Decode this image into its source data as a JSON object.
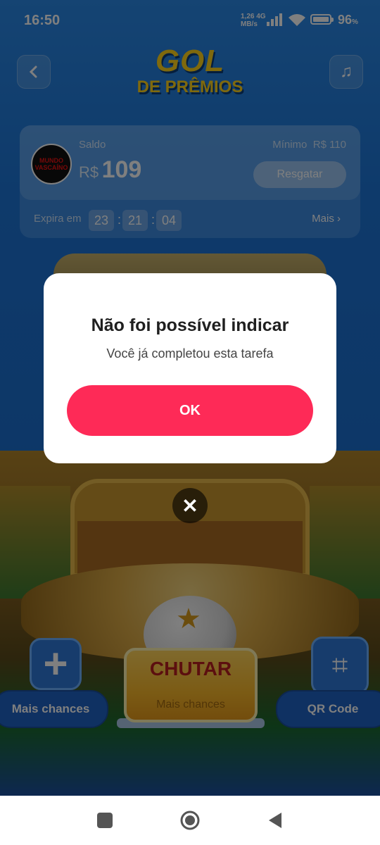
{
  "status_bar": {
    "time": "16:50",
    "net_speed": "1,26",
    "net_unit": "MB/s",
    "network": "4G",
    "battery_pct": "96",
    "battery_unit": "%"
  },
  "header": {
    "logo_line1": "GOL",
    "logo_line2": "DE PRÊMIOS",
    "back_icon": "chevron-left-icon",
    "music_icon": "music-note-icon"
  },
  "balance": {
    "avatar_text_1": "MUNDO",
    "avatar_text_2": "VASCAÍNO",
    "label": "Saldo",
    "currency": "R$",
    "amount": "109",
    "minimum_label": "Mínimo",
    "minimum_value": "R$ 110",
    "redeem_button": "Resgatar",
    "expires_label": "Expira em",
    "timer_h": "23",
    "timer_m": "21",
    "timer_s": "04",
    "more_link": "Mais"
  },
  "game": {
    "more_chances_left": "Mais chances",
    "kick_button": "CHUTAR",
    "kick_subtitle": "Mais chances",
    "qr_button": "QR Code"
  },
  "dialog": {
    "title": "Não foi possível indicar",
    "message": "Você já completou esta tarefa",
    "ok_button": "OK"
  },
  "colors": {
    "accent": "#fe2a57",
    "background": "#1c74d6",
    "logo": "#ffd21a"
  }
}
